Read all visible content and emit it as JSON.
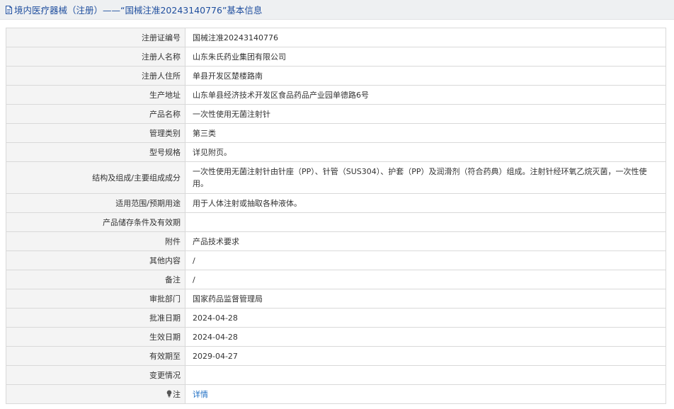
{
  "header": {
    "icon": "document-icon",
    "title": "境内医疗器械（注册）——“国械注准20243140776”基本信息"
  },
  "rows": [
    {
      "label": "注册证编号",
      "value": "国械注准20243140776"
    },
    {
      "label": "注册人名称",
      "value": "山东朱氏药业集团有限公司"
    },
    {
      "label": "注册人住所",
      "value": "单县开发区楚楼路南"
    },
    {
      "label": "生产地址",
      "value": "山东单县经济技术开发区食品药品产业园单德路6号"
    },
    {
      "label": "产品名称",
      "value": "一次性使用无菌注射针"
    },
    {
      "label": "管理类别",
      "value": "第三类"
    },
    {
      "label": "型号规格",
      "value": "详见附页。"
    },
    {
      "label": "结构及组成/主要组成成分",
      "value": "一次性使用无菌注射针由针座（PP）、针管（SUS304）、护套（PP）及润滑剂（符合药典）组成。注射针经环氧乙烷灭菌，一次性使用。"
    },
    {
      "label": "适用范围/预期用途",
      "value": "用于人体注射或抽取各种液体。"
    },
    {
      "label": "产品储存条件及有效期",
      "value": ""
    },
    {
      "label": "附件",
      "value": "产品技术要求"
    },
    {
      "label": "其他内容",
      "value": "/"
    },
    {
      "label": "备注",
      "value": "/"
    },
    {
      "label": "审批部门",
      "value": "国家药品监督管理局"
    },
    {
      "label": "批准日期",
      "value": "2024-04-28"
    },
    {
      "label": "生效日期",
      "value": "2024-04-28"
    },
    {
      "label": "有效期至",
      "value": "2029-04-27"
    },
    {
      "label": "变更情况",
      "value": ""
    }
  ],
  "note_row": {
    "icon": "lightbulb-icon",
    "label": "注",
    "link_text": "详情"
  }
}
